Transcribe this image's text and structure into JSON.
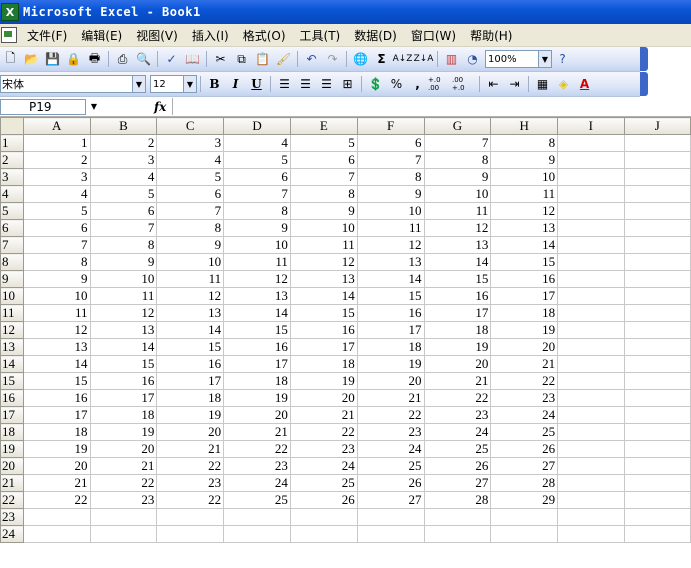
{
  "window": {
    "title": "Microsoft Excel - Book1",
    "app_icon": "excel-icon"
  },
  "menu": [
    "文件(F)",
    "编辑(E)",
    "视图(V)",
    "插入(I)",
    "格式(O)",
    "工具(T)",
    "数据(D)",
    "窗口(W)",
    "帮助(H)"
  ],
  "toolbar_standard": {
    "zoom": "100%",
    "buttons": [
      "new-icon",
      "open-icon",
      "save-icon",
      "permission-icon",
      "print-preview-icon",
      "print-icon",
      "spelling-icon",
      "research-icon",
      "cut-icon",
      "copy-icon",
      "paste-icon",
      "format-painter-icon",
      "undo-icon",
      "redo-icon",
      "hyperlink-icon",
      "autosum-icon",
      "sort-ascending-icon",
      "sort-descending-icon",
      "chart-wizard-icon",
      "drawing-icon",
      "help-icon"
    ]
  },
  "toolbar_formatting": {
    "font_name": "宋体",
    "font_size": "12",
    "bold": "B",
    "italic": "I",
    "underline": "U",
    "percent": "%",
    "comma": ",",
    "increase_decimal": "+.0 .00",
    "decrease_decimal": ".00 +.0",
    "font_color_label": "A"
  },
  "formula_bar": {
    "name_box": "P19",
    "fx_label": "fx",
    "content": ""
  },
  "sheet": {
    "columns": [
      "A",
      "B",
      "C",
      "D",
      "E",
      "F",
      "G",
      "H",
      "I",
      "J"
    ],
    "rows": [
      [
        "1",
        "1",
        "2",
        "3",
        "4",
        "5",
        "6",
        "7",
        "8"
      ],
      [
        "2",
        "2",
        "3",
        "4",
        "5",
        "6",
        "7",
        "8",
        "9"
      ],
      [
        "3",
        "3",
        "4",
        "5",
        "6",
        "7",
        "8",
        "9",
        "10"
      ],
      [
        "4",
        "4",
        "5",
        "6",
        "7",
        "8",
        "9",
        "10",
        "11"
      ],
      [
        "5",
        "5",
        "6",
        "7",
        "8",
        "9",
        "10",
        "11",
        "12"
      ],
      [
        "6",
        "6",
        "7",
        "8",
        "9",
        "10",
        "11",
        "12",
        "13"
      ],
      [
        "7",
        "7",
        "8",
        "9",
        "10",
        "11",
        "12",
        "13",
        "14"
      ],
      [
        "8",
        "8",
        "9",
        "10",
        "11",
        "12",
        "13",
        "14",
        "15"
      ],
      [
        "9",
        "9",
        "10",
        "11",
        "12",
        "13",
        "14",
        "15",
        "16"
      ],
      [
        "10",
        "10",
        "11",
        "12",
        "13",
        "14",
        "15",
        "16",
        "17"
      ],
      [
        "11",
        "11",
        "12",
        "13",
        "14",
        "15",
        "16",
        "17",
        "18"
      ],
      [
        "12",
        "12",
        "13",
        "14",
        "15",
        "16",
        "17",
        "18",
        "19"
      ],
      [
        "13",
        "13",
        "14",
        "15",
        "16",
        "17",
        "18",
        "19",
        "20"
      ],
      [
        "14",
        "14",
        "15",
        "16",
        "17",
        "18",
        "19",
        "20",
        "21"
      ],
      [
        "15",
        "15",
        "16",
        "17",
        "18",
        "19",
        "20",
        "21",
        "22"
      ],
      [
        "16",
        "16",
        "17",
        "18",
        "19",
        "20",
        "21",
        "22",
        "23"
      ],
      [
        "17",
        "17",
        "18",
        "19",
        "20",
        "21",
        "22",
        "23",
        "24"
      ],
      [
        "18",
        "18",
        "19",
        "20",
        "21",
        "22",
        "23",
        "24",
        "25"
      ],
      [
        "19",
        "19",
        "20",
        "21",
        "22",
        "23",
        "24",
        "25",
        "26"
      ],
      [
        "20",
        "20",
        "21",
        "22",
        "23",
        "24",
        "25",
        "26",
        "27"
      ],
      [
        "21",
        "21",
        "22",
        "23",
        "24",
        "25",
        "26",
        "27",
        "28"
      ],
      [
        "22",
        "22",
        "23",
        "22",
        "25",
        "26",
        "27",
        "28",
        "29"
      ],
      [
        "23",
        "",
        "",
        "",
        "",
        "",
        "",
        "",
        ""
      ],
      [
        "24",
        "",
        "",
        "",
        "",
        "",
        "",
        "",
        ""
      ]
    ]
  },
  "colors": {
    "titlebar": "#0a55d6",
    "menubar": "#ece9d8",
    "toolbar": "#dde6f7",
    "gridline": "#c8c8c8"
  }
}
